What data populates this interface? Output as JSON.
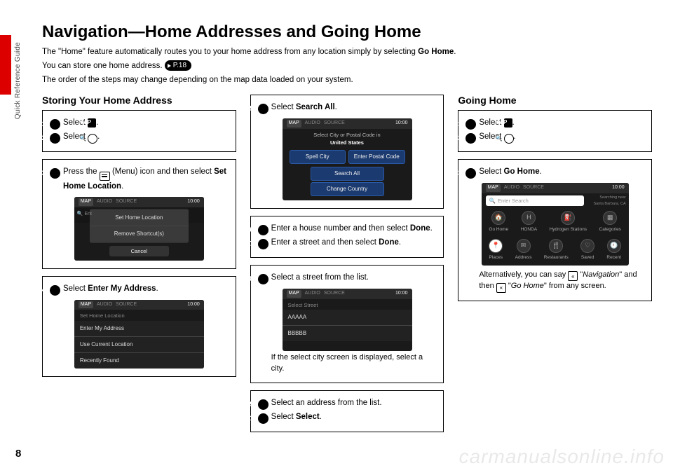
{
  "page_number": "8",
  "side_label": "Quick Reference Guide",
  "title": "Navigation—Home Addresses and Going Home",
  "intro1_a": "The \"Home\" feature automatically routes you to your home address from any location simply by selecting ",
  "intro1_b": "Go Home",
  "intro1_c": ".",
  "intro2": "You can store one home address.",
  "page_ref": "P.18",
  "intro3": "The order of the steps may change depending on the map data loaded on your system.",
  "col1": {
    "heading": "Storing Your Home Address",
    "s1": "Select ",
    "map_btn": "MAP",
    "s2": "Select ",
    "s3a": "Press the ",
    "s3b": " (Menu) icon and then select ",
    "s3c": "Set Home Location",
    "s4a": "Select ",
    "s4b": "Enter My Address",
    "screen1": {
      "clock": "10:00",
      "tab1": "MAP",
      "tab2": "AUDIO",
      "tab3": "SOURCE",
      "pop1": "Set Home Location",
      "pop2": "Remove Shortcut(s)",
      "cancel": "Cancel"
    },
    "screen2": {
      "clock": "10:00",
      "tab1": "MAP",
      "tab2": "AUDIO",
      "tab3": "SOURCE",
      "hdr": "Set Home Location",
      "i1": "Enter My Address",
      "i2": "Use Current Location",
      "i3": "Recently Found"
    }
  },
  "col2": {
    "s5a": "Select ",
    "s5b": "Search All",
    "screen3": {
      "clock": "10:00",
      "tab1": "MAP",
      "tab2": "AUDIO",
      "tab3": "SOURCE",
      "hdr": "Select City or Postal Code in",
      "hdr2": "United States",
      "b1": "Spell City",
      "b2": "Enter Postal Code",
      "b3": "Search All",
      "b4": "Change Country"
    },
    "s6a": "Enter a house number and then select ",
    "s6b": "Done",
    "s7a": "Enter a street and then select ",
    "s7b": "Done",
    "s8": "Select a street from the list.",
    "screen4": {
      "clock": "10:00",
      "tab1": "MAP",
      "tab2": "AUDIO",
      "tab3": "SOURCE",
      "hdr": "Select Street",
      "i1": "AAAAA",
      "i2": "BBBBB"
    },
    "s8_note": "If the select city screen is displayed, select a city.",
    "s9": "Select an address from the list.",
    "s10a": "Select ",
    "s10b": "Select"
  },
  "col3": {
    "heading": "Going Home",
    "s1": "Select ",
    "s2": "Select ",
    "s3a": "Select ",
    "s3b": "Go Home",
    "screen5": {
      "clock": "10:00",
      "tab1": "MAP",
      "tab2": "AUDIO",
      "tab3": "SOURCE",
      "search": "Enter Search",
      "loc": "Searching near Santa Barbara, CA",
      "ic1": "Go Home",
      "ic2": "HONDA",
      "ic3": "Hydrogen Stations",
      "ic4": "Categories",
      "ic5": "Places",
      "ic6": "Address",
      "ic7": "Restaurants",
      "ic8": "Saved",
      "ic9": "Recent"
    },
    "note1": "Alternatively, you can say ",
    "note2": "Navigation",
    "note3": "\" and then ",
    "note4": "Go Home",
    "note5": "\" from any screen."
  },
  "watermark": "carmanualsonline.info"
}
